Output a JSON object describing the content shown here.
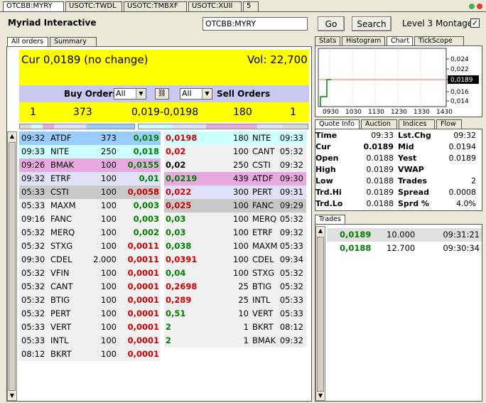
{
  "top_tabs": [
    "OTCBB:MYRY",
    "USOTC:TWDL",
    "USOTC:TMBXF",
    "USOTC:XUII",
    "5"
  ],
  "header": {
    "company": "Myriad Interactive",
    "symbol_value": "OTCBB:MYRY",
    "go_label": "Go",
    "search_label": "Search",
    "montage_label": "Level 3 Montage",
    "montage_check": "✓"
  },
  "left_tabs": [
    "All orders",
    "Summary"
  ],
  "summary": {
    "cur": "Cur 0,0189 (no change)",
    "vol": "Vol: 22,700"
  },
  "orders_bar": {
    "buy_label": "Buy Orders",
    "buy_filter": "All",
    "sell_filter": "All",
    "sell_label": "Sell Orders"
  },
  "inside": {
    "bid_count": "1",
    "bid_size": "373",
    "spread": "0,019-0,0198",
    "ask_size": "180",
    "ask_count": "1"
  },
  "buy_orders": [
    {
      "time": "09:32",
      "mm": "ATDF",
      "size": "373",
      "price": "0,019",
      "color": "g",
      "bg": "#99ccff"
    },
    {
      "time": "09:33",
      "mm": "NITE",
      "size": "250",
      "price": "0,018",
      "color": "g",
      "bg": "#ccffff"
    },
    {
      "time": "09:26",
      "mm": "BMAK",
      "size": "100",
      "price": "0,0155",
      "color": "g",
      "bg": "#e8a8e0"
    },
    {
      "time": "09:32",
      "mm": "ETRF",
      "size": "100",
      "price": "0,01",
      "color": "g",
      "bg": "#e0e0f8"
    },
    {
      "time": "05:33",
      "mm": "CSTI",
      "size": "100",
      "price": "0,0058",
      "color": "r",
      "bg": "#c8c8c8"
    },
    {
      "time": "05:33",
      "mm": "MAXM",
      "size": "100",
      "price": "0,003",
      "color": "g",
      "bg": "#f0f0f0"
    },
    {
      "time": "09:16",
      "mm": "FANC",
      "size": "100",
      "price": "0,003",
      "color": "g",
      "bg": "#f0f0f0"
    },
    {
      "time": "05:32",
      "mm": "MERQ",
      "size": "100",
      "price": "0,002",
      "color": "g",
      "bg": "#f0f0f0"
    },
    {
      "time": "05:32",
      "mm": "STXG",
      "size": "100",
      "price": "0,0011",
      "color": "r",
      "bg": "#f0f0f0"
    },
    {
      "time": "09:30",
      "mm": "CDEL",
      "size": "2.000",
      "price": "0,0011",
      "color": "r",
      "bg": "#f0f0f0"
    },
    {
      "time": "05:32",
      "mm": "VFIN",
      "size": "100",
      "price": "0,0001",
      "color": "r",
      "bg": "#f0f0f0"
    },
    {
      "time": "05:32",
      "mm": "CANT",
      "size": "100",
      "price": "0,0001",
      "color": "r",
      "bg": "#f0f0f0"
    },
    {
      "time": "05:32",
      "mm": "BTIG",
      "size": "100",
      "price": "0,0001",
      "color": "r",
      "bg": "#f0f0f0"
    },
    {
      "time": "05:32",
      "mm": "PERT",
      "size": "100",
      "price": "0,0001",
      "color": "r",
      "bg": "#f0f0f0"
    },
    {
      "time": "05:33",
      "mm": "VERT",
      "size": "100",
      "price": "0,0001",
      "color": "r",
      "bg": "#f0f0f0"
    },
    {
      "time": "05:33",
      "mm": "INTL",
      "size": "100",
      "price": "0,0001",
      "color": "r",
      "bg": "#f0f0f0"
    },
    {
      "time": "08:12",
      "mm": "BKRT",
      "size": "100",
      "price": "0,0001",
      "color": "r",
      "bg": "#f0f0f0"
    }
  ],
  "sell_orders": [
    {
      "price": "0,0198",
      "size": "180",
      "mm": "NITE",
      "time": "09:33",
      "color": "r",
      "bg": "#ccffff"
    },
    {
      "price": "0,02",
      "size": "100",
      "mm": "CANT",
      "time": "05:32",
      "color": "r",
      "bg": "#f0f0f0"
    },
    {
      "price": "0,02",
      "size": "250",
      "mm": "CSTI",
      "time": "09:32",
      "color": "k",
      "bg": "#f0f0f0"
    },
    {
      "price": "0,0219",
      "size": "439",
      "mm": "ATDF",
      "time": "09:30",
      "color": "g",
      "bg": "#e8a8e0"
    },
    {
      "price": "0,022",
      "size": "300",
      "mm": "PERT",
      "time": "09:31",
      "color": "r",
      "bg": "#e0e0f8"
    },
    {
      "price": "0,025",
      "size": "100",
      "mm": "FANC",
      "time": "09:29",
      "color": "r",
      "bg": "#c8c8c8"
    },
    {
      "price": "0,03",
      "size": "100",
      "mm": "MERQ",
      "time": "05:32",
      "color": "g",
      "bg": "#f0f0f0"
    },
    {
      "price": "0,03",
      "size": "100",
      "mm": "ETRF",
      "time": "09:32",
      "color": "g",
      "bg": "#f0f0f0"
    },
    {
      "price": "0,038",
      "size": "100",
      "mm": "MAXM",
      "time": "05:33",
      "color": "g",
      "bg": "#f0f0f0"
    },
    {
      "price": "0,0391",
      "size": "100",
      "mm": "CDEL",
      "time": "09:34",
      "color": "r",
      "bg": "#f0f0f0"
    },
    {
      "price": "0,04",
      "size": "100",
      "mm": "STXG",
      "time": "05:32",
      "color": "g",
      "bg": "#f0f0f0"
    },
    {
      "price": "0,2698",
      "size": "25",
      "mm": "BTIG",
      "time": "05:32",
      "color": "r",
      "bg": "#f0f0f0"
    },
    {
      "price": "0,289",
      "size": "25",
      "mm": "INTL",
      "time": "05:33",
      "color": "r",
      "bg": "#f0f0f0"
    },
    {
      "price": "0,51",
      "size": "10",
      "mm": "VERT",
      "time": "05:33",
      "color": "g",
      "bg": "#f0f0f0"
    },
    {
      "price": "2",
      "size": "1",
      "mm": "BKRT",
      "time": "08:12",
      "color": "g",
      "bg": "#f0f0f0"
    },
    {
      "price": "2",
      "size": "1",
      "mm": "BMAK",
      "time": "09:32",
      "color": "g",
      "bg": "#f0f0f0"
    }
  ],
  "right_tabs": [
    "Stats",
    "Histogram",
    "Chart",
    "TickScope"
  ],
  "mini_chart": {
    "y_labels": [
      "0,024",
      "0,022",
      "0,0189",
      "0,016",
      "0,014"
    ],
    "x_labels": [
      "0930",
      "1030",
      "1130",
      "1230",
      "1330",
      "1430"
    ],
    "current": "0,0189"
  },
  "quote_tabs": [
    "Quote Info",
    "Auction",
    "Indices",
    "Flow"
  ],
  "quote": [
    {
      "l1": "Time",
      "v1": "09:33",
      "l2": "Lst.Chg",
      "v2": "09:32"
    },
    {
      "l1": "Cur",
      "v1": "0.0189",
      "l2": "Mid",
      "v2": "0.0194"
    },
    {
      "l1": "Open",
      "v1": "0.0188",
      "l2": "Yest",
      "v2": "0.0189"
    },
    {
      "l1": "High",
      "v1": "0.0189",
      "l2": "VWAP",
      "v2": ""
    },
    {
      "l1": "Low",
      "v1": "0.0188",
      "l2": "Trades",
      "v2": "2"
    },
    {
      "l1": "Trd.Hi",
      "v1": "0.0189",
      "l2": "Spread",
      "v2": "0.0008"
    },
    {
      "l1": "Trd.Lo",
      "v1": "0.0188",
      "l2": "Sprd %",
      "v2": "4.0%"
    }
  ],
  "trades_tab": "Trades",
  "trades": [
    {
      "price": "0,0189",
      "size": "10.000",
      "time": "09:31:21"
    },
    {
      "price": "0,0188",
      "size": "12.700",
      "time": "09:30:34"
    }
  ]
}
